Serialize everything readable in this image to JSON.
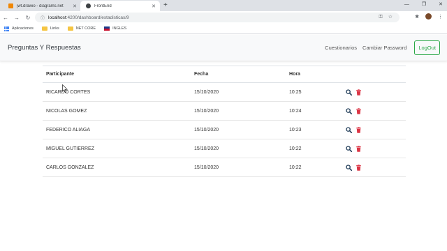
{
  "browser": {
    "tabs": [
      {
        "title": "jwt.drawio - diagrams.net",
        "active": false,
        "icon": "drawio-icon"
      },
      {
        "title": "FrontEnd",
        "active": true,
        "icon": "angular-icon"
      }
    ],
    "url_host": "localhost",
    "url_path": ":4200/dashboard/estadisticas/9",
    "bookmarks": [
      {
        "label": "Aplicaciones",
        "icon": "apps-grid-icon"
      },
      {
        "label": "Links",
        "icon": "folder-icon"
      },
      {
        "label": "NET CORE",
        "icon": "folder-icon"
      },
      {
        "label": "INGLES",
        "icon": "flag-icon"
      }
    ]
  },
  "navbar": {
    "brand": "Preguntas Y Respuestas",
    "links": [
      "Cuestionarios",
      "Cambiar Password"
    ],
    "logout": "LogOut"
  },
  "table": {
    "headers": {
      "participante": "Participante",
      "fecha": "Fecha",
      "hora": "Hora"
    },
    "rows": [
      {
        "participante": "RICARDO CORTES",
        "fecha": "15/10/2020",
        "hora": "10:25"
      },
      {
        "participante": "NICOLAS GOMEZ",
        "fecha": "15/10/2020",
        "hora": "10:24"
      },
      {
        "participante": "FEDERICO ALIAGA",
        "fecha": "15/10/2020",
        "hora": "10:23"
      },
      {
        "participante": "MIGUEL GUTIERREZ",
        "fecha": "15/10/2020",
        "hora": "10:22"
      },
      {
        "participante": "CARLOS GONZALEZ",
        "fecha": "15/10/2020",
        "hora": "10:22"
      }
    ]
  },
  "colors": {
    "accent_green": "#28a745",
    "search_icon": "#1f3b57",
    "trash_icon": "#dc3545"
  }
}
